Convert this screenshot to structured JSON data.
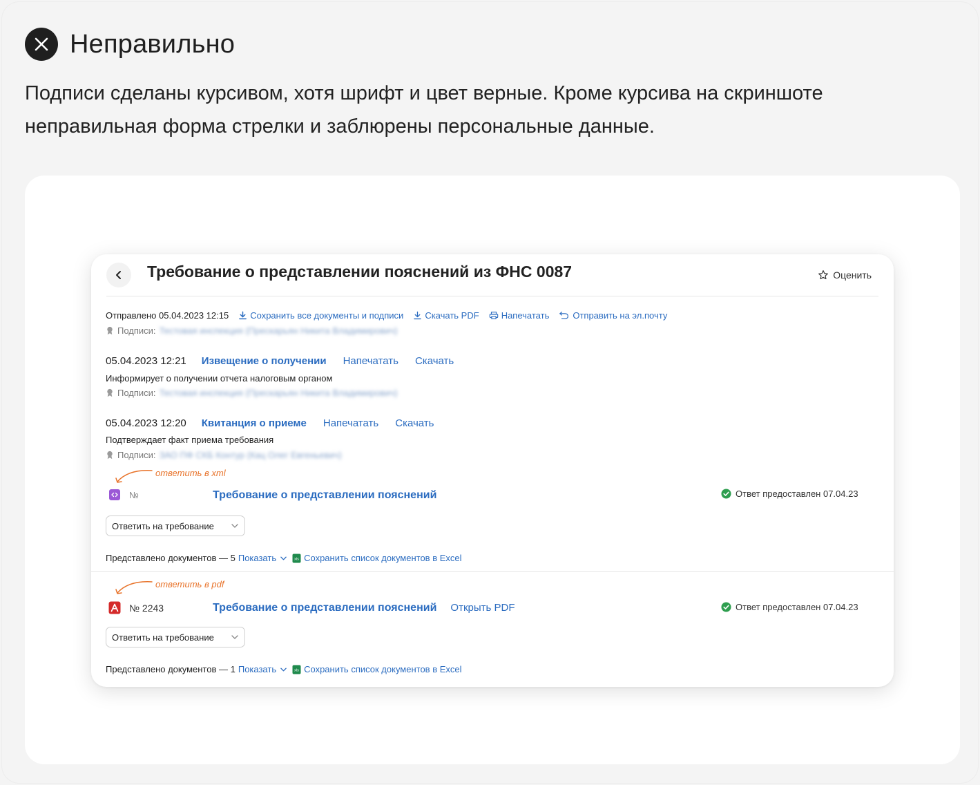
{
  "heading": {
    "title": "Неправильно"
  },
  "description": "Подписи сделаны курсивом, хотя шрифт и цвет верные. Кроме курсива на скриншоте неправильная форма стрелки и заблюрены персональные данные.",
  "screenshot": {
    "title": "Требование о представлении пояснений из ФНС 0087",
    "rate_label": "Оценить",
    "sent_label": "Отправлено 05.04.2023 12:15",
    "toolbar": {
      "save_all": "Сохранить все документы и подписи",
      "download_pdf": "Скачать PDF",
      "print": "Напечатать",
      "send_email": "Отправить на эл.почту"
    },
    "signatures_label": "Подписи:",
    "blurred_sig_1": "Тестовая инспекция (Прескарьян Никита Владимирович)",
    "blurred_sig_2": "Тестовая инспекция (Прескарьян Никита Владимирович)",
    "blurred_sig_3": "ЗАО ПФ СКБ Контур (Кац Олег Евгеньевич)",
    "event1": {
      "date": "05.04.2023 12:21",
      "doc": "Извещение о получении",
      "print": "Напечатать",
      "download": "Скачать",
      "desc": "Информирует о получении отчета налоговым органом"
    },
    "event2": {
      "date": "05.04.2023 12:20",
      "doc": "Квитанция о приеме",
      "print": "Напечатать",
      "download": "Скачать",
      "desc": "Подтверждает факт приема требования"
    },
    "req1": {
      "annotation": "ответить в xml",
      "number": "№",
      "doc": "Требование о представлении пояснений",
      "status": "Ответ предоставлен 07.04.23",
      "dropdown": "Ответить на требование",
      "footer_prefix": "Представлено документов — 5",
      "show": "Показать",
      "excel": "Сохранить список документов в Excel"
    },
    "req2": {
      "annotation": "ответить в pdf",
      "number": "№ 2243",
      "doc": "Требование о представлении пояснений",
      "open_pdf": "Открыть PDF",
      "status": "Ответ предоставлен 07.04.23",
      "dropdown": "Ответить на требование",
      "footer_prefix": "Представлено документов — 1",
      "show": "Показать",
      "excel": "Сохранить список документов в Excel"
    },
    "colors": {
      "link": "#2b6cc0",
      "annotation": "#e8732a",
      "success": "#2e9e4f",
      "xml_badge": "#9b59d6",
      "pdf_badge": "#d42a2a"
    }
  }
}
